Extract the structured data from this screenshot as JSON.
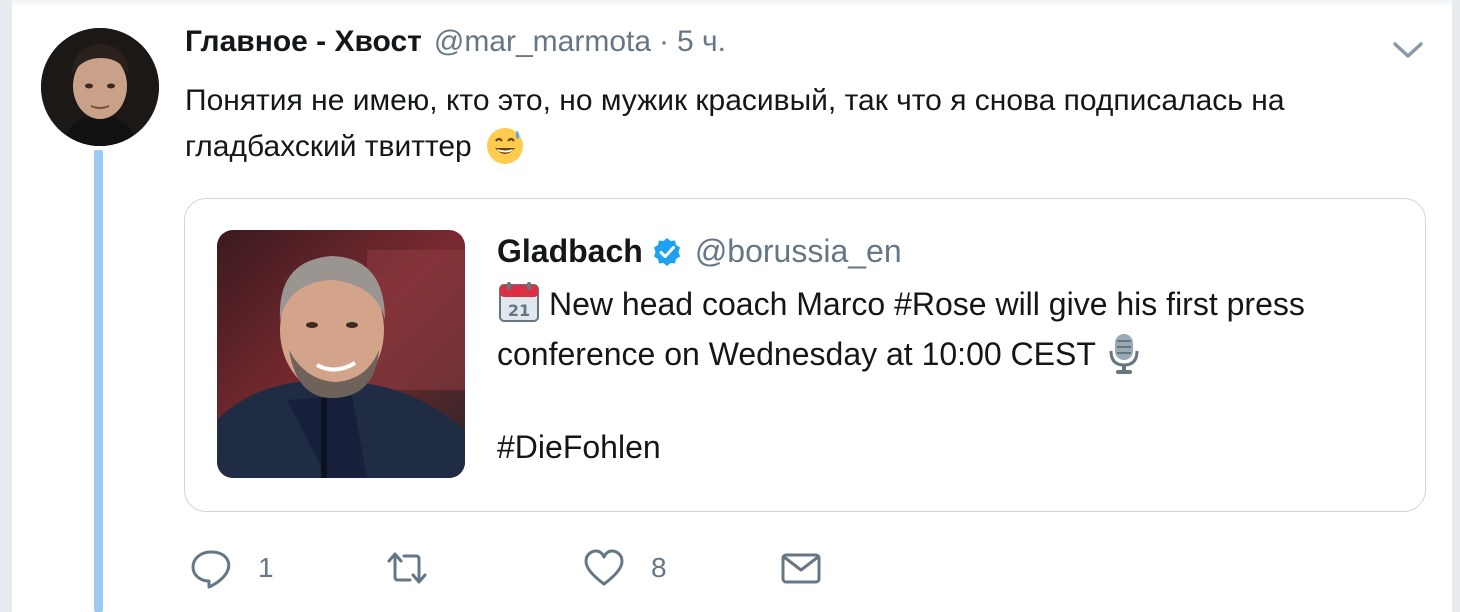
{
  "tweet": {
    "display_name": "Главное - Хвост",
    "handle": "@mar_marmota",
    "separator": "·",
    "time": "5 ч.",
    "text": "Понятия не имею, кто это, но мужик красивый, так что я снова подписалась на гладбахский твиттер",
    "text_emoji": "sweat-smile-emoji"
  },
  "quoted": {
    "display_name": "Gladbach",
    "handle": "@borussia_en",
    "verified": true,
    "line1": "New head coach Marco #Rose will give his first press conference on Wednesday at 10:00 CEST",
    "calendar_emoji": "calendar-emoji",
    "mic_emoji": "microphone-emoji",
    "hashtag": "#DieFohlen"
  },
  "actions": {
    "reply_count": "1",
    "retweet_count": "",
    "like_count": "8"
  },
  "colors": {
    "accent": "#1da1f2",
    "thread_line": "#9ccaf0",
    "muted_text": "#657786",
    "border": "#ccd6dd"
  }
}
